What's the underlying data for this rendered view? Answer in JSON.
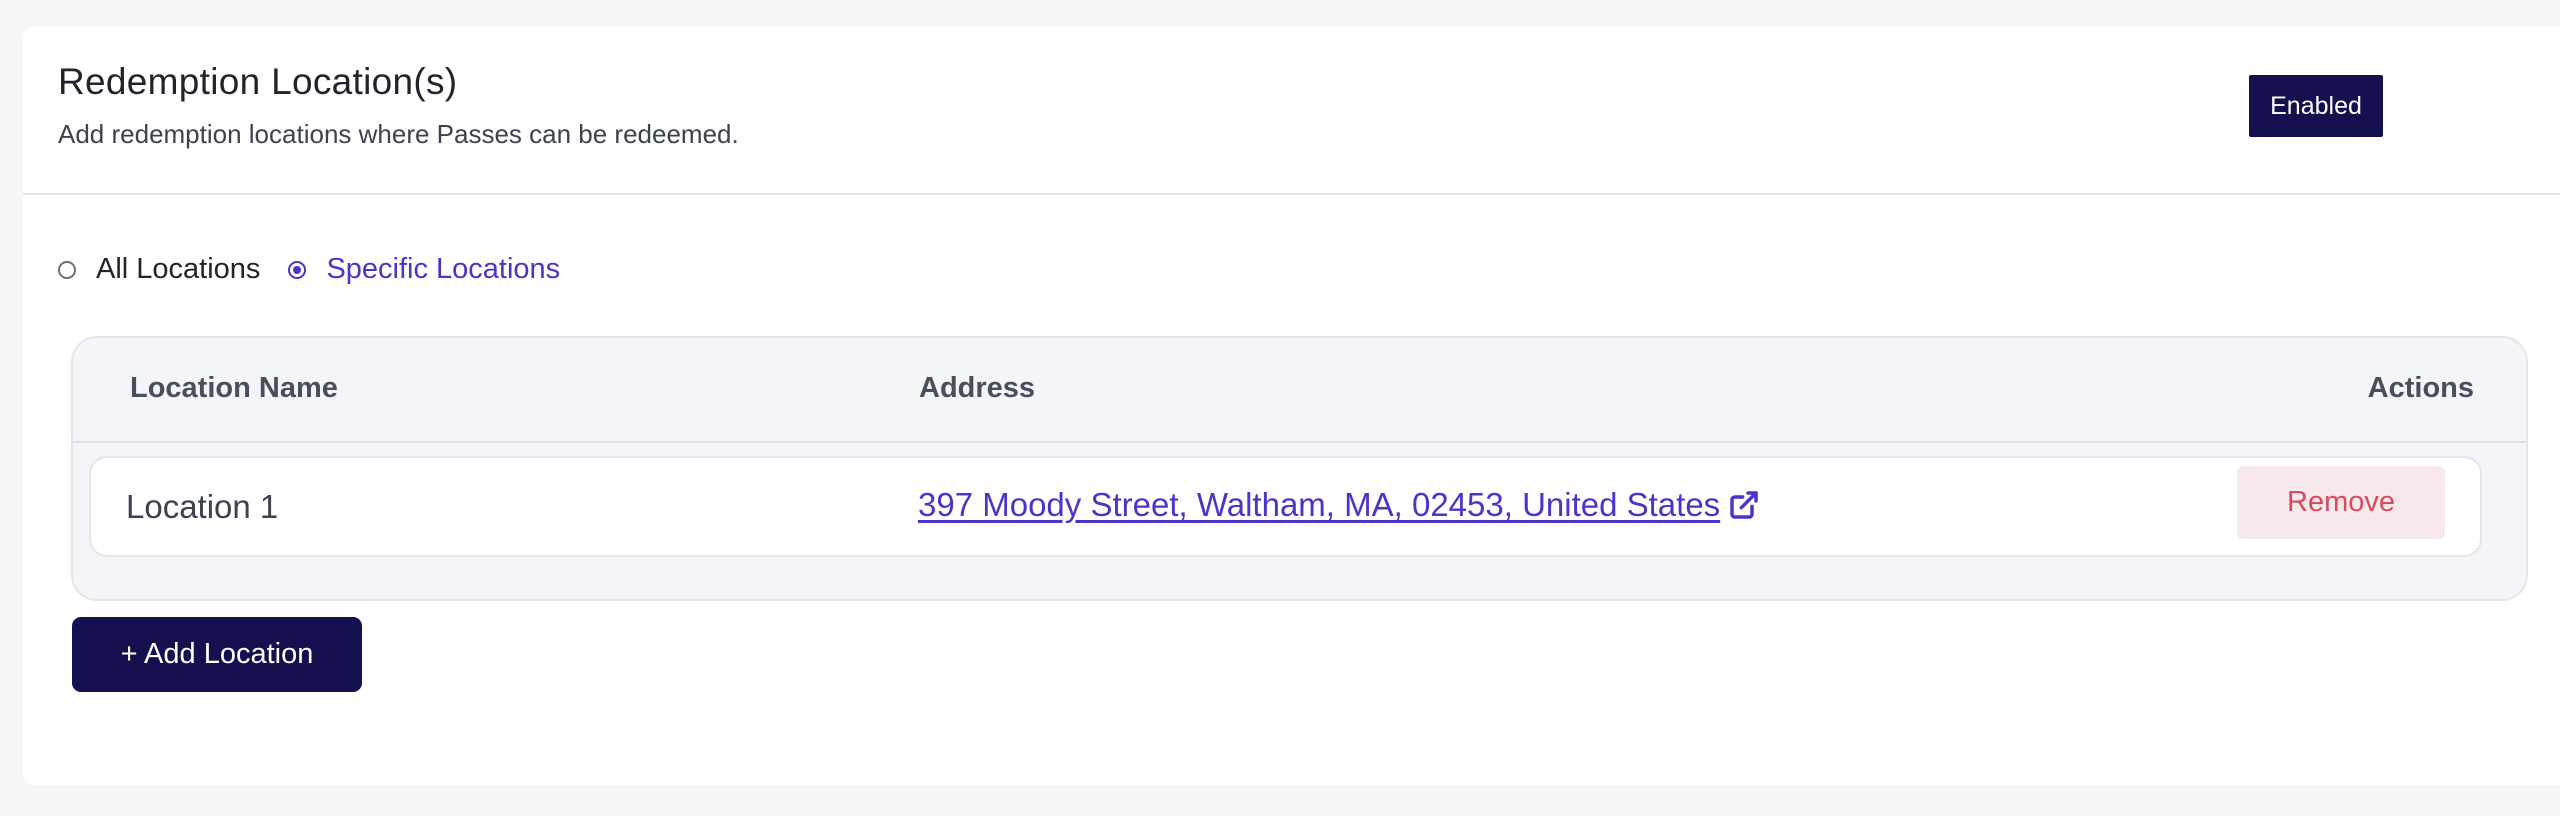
{
  "section": {
    "title": "Redemption Location(s)",
    "subtitle": "Add redemption locations where Passes can be redeemed."
  },
  "toggle": {
    "label": "Enabled",
    "state": "on"
  },
  "radio_options": [
    {
      "label": "All Locations",
      "selected": false
    },
    {
      "label": "Specific Locations",
      "selected": true
    }
  ],
  "table": {
    "columns": [
      "Location Name",
      "Address",
      "Actions"
    ],
    "rows": [
      {
        "name": "Location 1",
        "address": "397 Moody Street, Waltham, MA, 02453, United States",
        "action_label": "Remove"
      }
    ]
  },
  "add_location_label": "+ Add Location",
  "icons": {
    "external_link": "external-link-icon"
  },
  "colors": {
    "primary": "#14104f",
    "accent": "#4a35c9",
    "danger": "#d94a5d",
    "danger_bg": "#f7e8ec"
  }
}
